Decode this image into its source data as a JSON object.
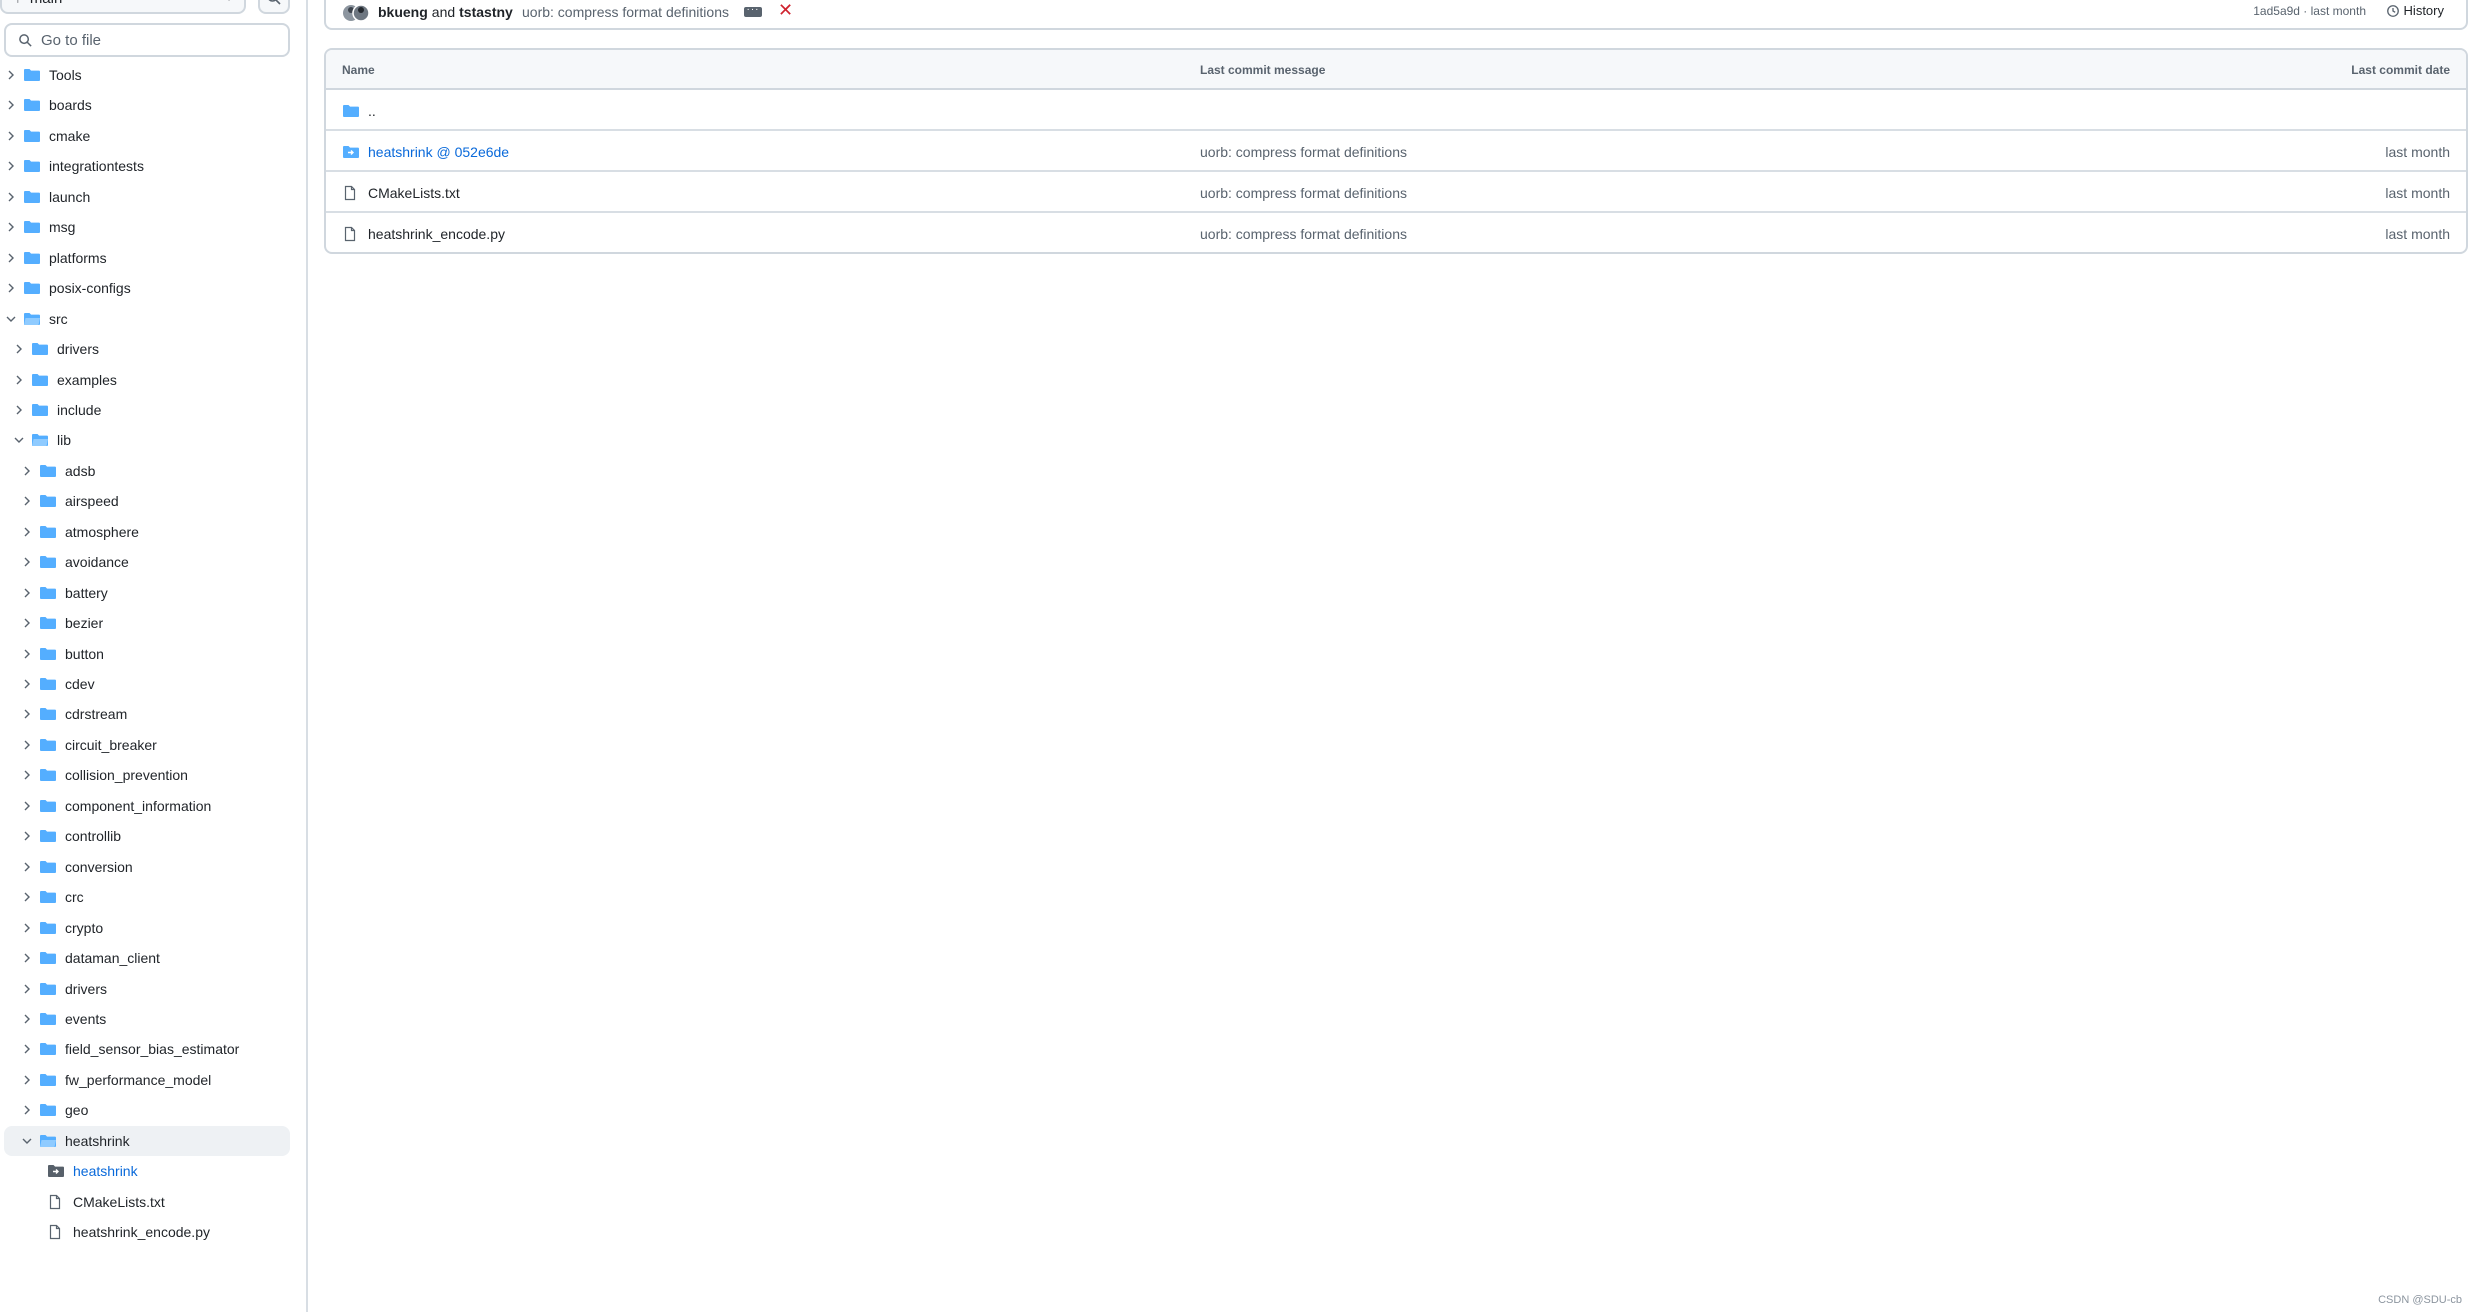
{
  "sidebar": {
    "branch": "main",
    "goto_placeholder": "Go to file",
    "tree": [
      {
        "label": "Tools",
        "depth": 0,
        "type": "folder",
        "expanded": false
      },
      {
        "label": "boards",
        "depth": 0,
        "type": "folder",
        "expanded": false
      },
      {
        "label": "cmake",
        "depth": 0,
        "type": "folder",
        "expanded": false
      },
      {
        "label": "integrationtests",
        "depth": 0,
        "type": "folder",
        "expanded": false
      },
      {
        "label": "launch",
        "depth": 0,
        "type": "folder",
        "expanded": false
      },
      {
        "label": "msg",
        "depth": 0,
        "type": "folder",
        "expanded": false
      },
      {
        "label": "platforms",
        "depth": 0,
        "type": "folder",
        "expanded": false
      },
      {
        "label": "posix-configs",
        "depth": 0,
        "type": "folder",
        "expanded": false
      },
      {
        "label": "src",
        "depth": 0,
        "type": "folder",
        "expanded": true
      },
      {
        "label": "drivers",
        "depth": 1,
        "type": "folder",
        "expanded": false
      },
      {
        "label": "examples",
        "depth": 1,
        "type": "folder",
        "expanded": false
      },
      {
        "label": "include",
        "depth": 1,
        "type": "folder",
        "expanded": false
      },
      {
        "label": "lib",
        "depth": 1,
        "type": "folder",
        "expanded": true
      },
      {
        "label": "adsb",
        "depth": 2,
        "type": "folder",
        "expanded": false
      },
      {
        "label": "airspeed",
        "depth": 2,
        "type": "folder",
        "expanded": false
      },
      {
        "label": "atmosphere",
        "depth": 2,
        "type": "folder",
        "expanded": false
      },
      {
        "label": "avoidance",
        "depth": 2,
        "type": "folder",
        "expanded": false
      },
      {
        "label": "battery",
        "depth": 2,
        "type": "folder",
        "expanded": false
      },
      {
        "label": "bezier",
        "depth": 2,
        "type": "folder",
        "expanded": false
      },
      {
        "label": "button",
        "depth": 2,
        "type": "folder",
        "expanded": false
      },
      {
        "label": "cdev",
        "depth": 2,
        "type": "folder",
        "expanded": false
      },
      {
        "label": "cdrstream",
        "depth": 2,
        "type": "folder",
        "expanded": false
      },
      {
        "label": "circuit_breaker",
        "depth": 2,
        "type": "folder",
        "expanded": false
      },
      {
        "label": "collision_prevention",
        "depth": 2,
        "type": "folder",
        "expanded": false
      },
      {
        "label": "component_information",
        "depth": 2,
        "type": "folder",
        "expanded": false
      },
      {
        "label": "controllib",
        "depth": 2,
        "type": "folder",
        "expanded": false
      },
      {
        "label": "conversion",
        "depth": 2,
        "type": "folder",
        "expanded": false
      },
      {
        "label": "crc",
        "depth": 2,
        "type": "folder",
        "expanded": false
      },
      {
        "label": "crypto",
        "depth": 2,
        "type": "folder",
        "expanded": false
      },
      {
        "label": "dataman_client",
        "depth": 2,
        "type": "folder",
        "expanded": false
      },
      {
        "label": "drivers",
        "depth": 2,
        "type": "folder",
        "expanded": false
      },
      {
        "label": "events",
        "depth": 2,
        "type": "folder",
        "expanded": false
      },
      {
        "label": "field_sensor_bias_estimator",
        "depth": 2,
        "type": "folder",
        "expanded": false
      },
      {
        "label": "fw_performance_model",
        "depth": 2,
        "type": "folder",
        "expanded": false
      },
      {
        "label": "geo",
        "depth": 2,
        "type": "folder",
        "expanded": false
      },
      {
        "label": "heatshrink",
        "depth": 2,
        "type": "folder",
        "expanded": true,
        "selected": true
      },
      {
        "label": "heatshrink",
        "depth": 3,
        "type": "submodule"
      },
      {
        "label": "CMakeLists.txt",
        "depth": 3,
        "type": "file"
      },
      {
        "label": "heatshrink_encode.py",
        "depth": 3,
        "type": "file"
      }
    ]
  },
  "commit": {
    "author1": "bkueng",
    "and": "and",
    "author2": "tstastny",
    "message": "uorb: compress format definitions",
    "meta": "1ad5a9d · last month",
    "history_label": "History"
  },
  "table": {
    "headers": {
      "name": "Name",
      "message": "Last commit message",
      "date": "Last commit date"
    },
    "parent": "..",
    "rows": [
      {
        "name": "heatshrink @ 052e6de",
        "type": "submodule",
        "message": "uorb: compress format definitions",
        "date": "last month"
      },
      {
        "name": "CMakeLists.txt",
        "type": "file",
        "message": "uorb: compress format definitions",
        "date": "last month"
      },
      {
        "name": "heatshrink_encode.py",
        "type": "file",
        "message": "uorb: compress format definitions",
        "date": "last month"
      }
    ]
  },
  "watermark": "CSDN @SDU-cb",
  "colors": {
    "folder": "#54aeff",
    "link": "#0969da",
    "muted": "#59636e",
    "fail": "#cf222e"
  }
}
